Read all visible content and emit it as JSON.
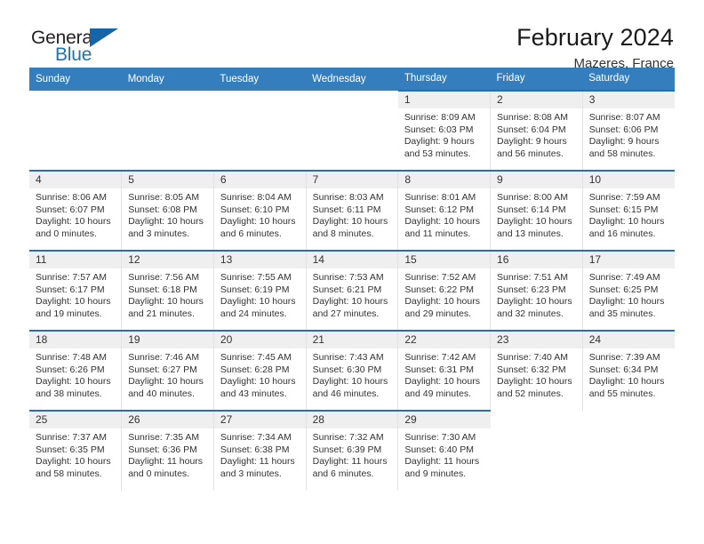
{
  "logo": {
    "word_one": "General",
    "word_two": "Blue",
    "triangle": "blue-triangle"
  },
  "header": {
    "month_title": "February 2024",
    "location": "Mazeres, France"
  },
  "calendar": {
    "day_headers": [
      "Sunday",
      "Monday",
      "Tuesday",
      "Wednesday",
      "Thursday",
      "Friday",
      "Saturday"
    ],
    "colors": {
      "header_blue": "#357ebd",
      "row_border_blue": "#2a6fad",
      "daynum_band": "#efefef",
      "text": "#333333",
      "logo_blue": "#1d72b8"
    },
    "weeks": [
      [
        {
          "empty": true
        },
        {
          "empty": true
        },
        {
          "empty": true
        },
        {
          "empty": true
        },
        {
          "day": "1",
          "sunrise": "Sunrise: 8:09 AM",
          "sunset": "Sunset: 6:03 PM",
          "daylight_1": "Daylight: 9 hours",
          "daylight_2": "and 53 minutes."
        },
        {
          "day": "2",
          "sunrise": "Sunrise: 8:08 AM",
          "sunset": "Sunset: 6:04 PM",
          "daylight_1": "Daylight: 9 hours",
          "daylight_2": "and 56 minutes."
        },
        {
          "day": "3",
          "sunrise": "Sunrise: 8:07 AM",
          "sunset": "Sunset: 6:06 PM",
          "daylight_1": "Daylight: 9 hours",
          "daylight_2": "and 58 minutes."
        }
      ],
      [
        {
          "day": "4",
          "sunrise": "Sunrise: 8:06 AM",
          "sunset": "Sunset: 6:07 PM",
          "daylight_1": "Daylight: 10 hours",
          "daylight_2": "and 0 minutes."
        },
        {
          "day": "5",
          "sunrise": "Sunrise: 8:05 AM",
          "sunset": "Sunset: 6:08 PM",
          "daylight_1": "Daylight: 10 hours",
          "daylight_2": "and 3 minutes."
        },
        {
          "day": "6",
          "sunrise": "Sunrise: 8:04 AM",
          "sunset": "Sunset: 6:10 PM",
          "daylight_1": "Daylight: 10 hours",
          "daylight_2": "and 6 minutes."
        },
        {
          "day": "7",
          "sunrise": "Sunrise: 8:03 AM",
          "sunset": "Sunset: 6:11 PM",
          "daylight_1": "Daylight: 10 hours",
          "daylight_2": "and 8 minutes."
        },
        {
          "day": "8",
          "sunrise": "Sunrise: 8:01 AM",
          "sunset": "Sunset: 6:12 PM",
          "daylight_1": "Daylight: 10 hours",
          "daylight_2": "and 11 minutes."
        },
        {
          "day": "9",
          "sunrise": "Sunrise: 8:00 AM",
          "sunset": "Sunset: 6:14 PM",
          "daylight_1": "Daylight: 10 hours",
          "daylight_2": "and 13 minutes."
        },
        {
          "day": "10",
          "sunrise": "Sunrise: 7:59 AM",
          "sunset": "Sunset: 6:15 PM",
          "daylight_1": "Daylight: 10 hours",
          "daylight_2": "and 16 minutes."
        }
      ],
      [
        {
          "day": "11",
          "sunrise": "Sunrise: 7:57 AM",
          "sunset": "Sunset: 6:17 PM",
          "daylight_1": "Daylight: 10 hours",
          "daylight_2": "and 19 minutes."
        },
        {
          "day": "12",
          "sunrise": "Sunrise: 7:56 AM",
          "sunset": "Sunset: 6:18 PM",
          "daylight_1": "Daylight: 10 hours",
          "daylight_2": "and 21 minutes."
        },
        {
          "day": "13",
          "sunrise": "Sunrise: 7:55 AM",
          "sunset": "Sunset: 6:19 PM",
          "daylight_1": "Daylight: 10 hours",
          "daylight_2": "and 24 minutes."
        },
        {
          "day": "14",
          "sunrise": "Sunrise: 7:53 AM",
          "sunset": "Sunset: 6:21 PM",
          "daylight_1": "Daylight: 10 hours",
          "daylight_2": "and 27 minutes."
        },
        {
          "day": "15",
          "sunrise": "Sunrise: 7:52 AM",
          "sunset": "Sunset: 6:22 PM",
          "daylight_1": "Daylight: 10 hours",
          "daylight_2": "and 29 minutes."
        },
        {
          "day": "16",
          "sunrise": "Sunrise: 7:51 AM",
          "sunset": "Sunset: 6:23 PM",
          "daylight_1": "Daylight: 10 hours",
          "daylight_2": "and 32 minutes."
        },
        {
          "day": "17",
          "sunrise": "Sunrise: 7:49 AM",
          "sunset": "Sunset: 6:25 PM",
          "daylight_1": "Daylight: 10 hours",
          "daylight_2": "and 35 minutes."
        }
      ],
      [
        {
          "day": "18",
          "sunrise": "Sunrise: 7:48 AM",
          "sunset": "Sunset: 6:26 PM",
          "daylight_1": "Daylight: 10 hours",
          "daylight_2": "and 38 minutes."
        },
        {
          "day": "19",
          "sunrise": "Sunrise: 7:46 AM",
          "sunset": "Sunset: 6:27 PM",
          "daylight_1": "Daylight: 10 hours",
          "daylight_2": "and 40 minutes."
        },
        {
          "day": "20",
          "sunrise": "Sunrise: 7:45 AM",
          "sunset": "Sunset: 6:28 PM",
          "daylight_1": "Daylight: 10 hours",
          "daylight_2": "and 43 minutes."
        },
        {
          "day": "21",
          "sunrise": "Sunrise: 7:43 AM",
          "sunset": "Sunset: 6:30 PM",
          "daylight_1": "Daylight: 10 hours",
          "daylight_2": "and 46 minutes."
        },
        {
          "day": "22",
          "sunrise": "Sunrise: 7:42 AM",
          "sunset": "Sunset: 6:31 PM",
          "daylight_1": "Daylight: 10 hours",
          "daylight_2": "and 49 minutes."
        },
        {
          "day": "23",
          "sunrise": "Sunrise: 7:40 AM",
          "sunset": "Sunset: 6:32 PM",
          "daylight_1": "Daylight: 10 hours",
          "daylight_2": "and 52 minutes."
        },
        {
          "day": "24",
          "sunrise": "Sunrise: 7:39 AM",
          "sunset": "Sunset: 6:34 PM",
          "daylight_1": "Daylight: 10 hours",
          "daylight_2": "and 55 minutes."
        }
      ],
      [
        {
          "day": "25",
          "sunrise": "Sunrise: 7:37 AM",
          "sunset": "Sunset: 6:35 PM",
          "daylight_1": "Daylight: 10 hours",
          "daylight_2": "and 58 minutes."
        },
        {
          "day": "26",
          "sunrise": "Sunrise: 7:35 AM",
          "sunset": "Sunset: 6:36 PM",
          "daylight_1": "Daylight: 11 hours",
          "daylight_2": "and 0 minutes."
        },
        {
          "day": "27",
          "sunrise": "Sunrise: 7:34 AM",
          "sunset": "Sunset: 6:38 PM",
          "daylight_1": "Daylight: 11 hours",
          "daylight_2": "and 3 minutes."
        },
        {
          "day": "28",
          "sunrise": "Sunrise: 7:32 AM",
          "sunset": "Sunset: 6:39 PM",
          "daylight_1": "Daylight: 11 hours",
          "daylight_2": "and 6 minutes."
        },
        {
          "day": "29",
          "sunrise": "Sunrise: 7:30 AM",
          "sunset": "Sunset: 6:40 PM",
          "daylight_1": "Daylight: 11 hours",
          "daylight_2": "and 9 minutes."
        },
        {
          "empty": true
        },
        {
          "empty": true
        }
      ]
    ]
  }
}
